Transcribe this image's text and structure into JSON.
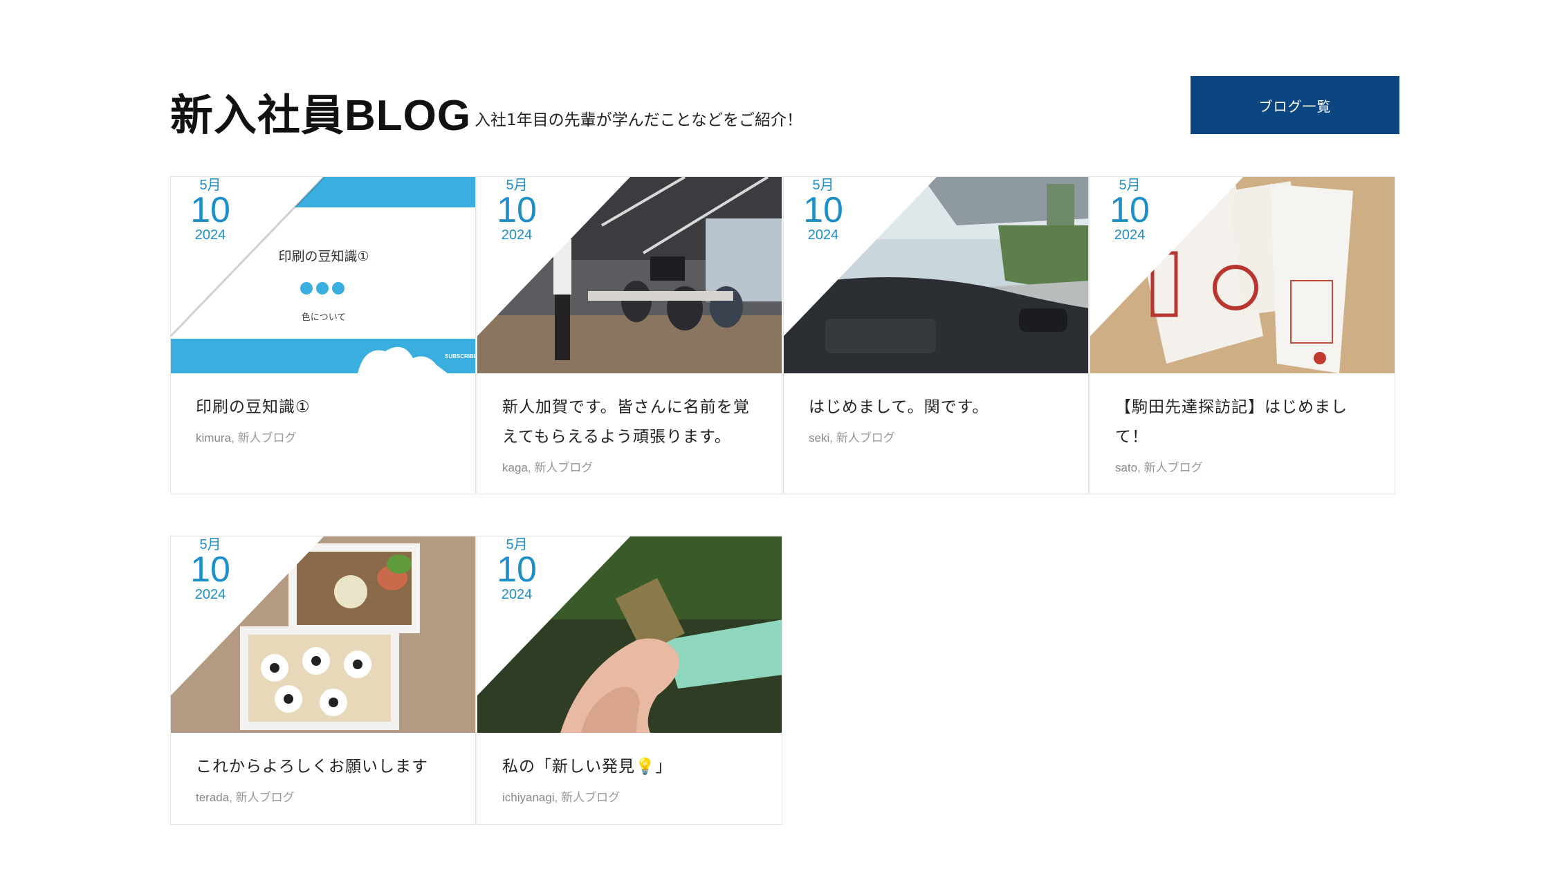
{
  "header": {
    "title": "新入社員BLOG",
    "subtitle": "入社1年目の先輩が学んだことなどをご紹介！",
    "list_button": "ブログ一覧"
  },
  "colors": {
    "accent": "#1c8fc9",
    "button": "#0b4582"
  },
  "posts": [
    {
      "month": "5月",
      "day": "10",
      "year": "2024",
      "title": "印刷の豆知識①",
      "author": "kimura",
      "sep": ",",
      "category": "新人ブログ",
      "thumb": {
        "heading": "印刷の豆知識①",
        "sub": "色について",
        "tag": "SUBSCRIBE"
      }
    },
    {
      "month": "5月",
      "day": "10",
      "year": "2024",
      "title": "新人加賀です。皆さんに名前を覚えてもらえるよう頑張ります。",
      "author": "kaga",
      "sep": ",",
      "category": "新人ブログ"
    },
    {
      "month": "5月",
      "day": "10",
      "year": "2024",
      "title": "はじめまして。関です。",
      "author": "seki",
      "sep": ",",
      "category": "新人ブログ"
    },
    {
      "month": "5月",
      "day": "10",
      "year": "2024",
      "title": "【駒田先達探訪記】はじめまして！",
      "author": "sato",
      "sep": ",",
      "category": "新人ブログ"
    },
    {
      "month": "5月",
      "day": "10",
      "year": "2024",
      "title": "これからよろしくお願いします",
      "author": "terada",
      "sep": ",",
      "category": "新人ブログ"
    },
    {
      "month": "5月",
      "day": "10",
      "year": "2024",
      "title": "私の「新しい発見💡」",
      "author": "ichiyanagi",
      "sep": ",",
      "category": "新人ブログ"
    }
  ]
}
